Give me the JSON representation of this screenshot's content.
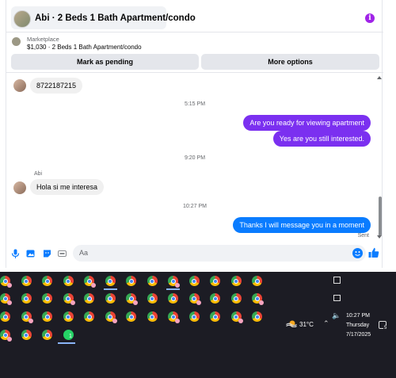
{
  "header": {
    "title": "Abi · 2 Beds 1 Bath Apartment/condo",
    "info_icon": "info-icon",
    "accent": "#a023e8"
  },
  "marketplace": {
    "label": "Marketplace",
    "item": "$1,030 · 2 Beds 1 Bath Apartment/condo",
    "buttons": [
      "Mark as pending",
      "More options"
    ]
  },
  "messages": [
    {
      "type": "in",
      "text": "8722187215"
    },
    {
      "type": "time",
      "text": "5:15 PM"
    },
    {
      "type": "out",
      "text": "Are you ready for viewing apartment"
    },
    {
      "type": "out",
      "text": "Yes are you still interested."
    },
    {
      "type": "time",
      "text": "9:20 PM"
    },
    {
      "type": "sender",
      "text": "Abi"
    },
    {
      "type": "in",
      "text": "Hola si me interesa"
    },
    {
      "type": "time",
      "text": "10:27 PM"
    },
    {
      "type": "out",
      "text": "Thanks I will message you in a moment"
    },
    {
      "type": "status",
      "text": "Sent"
    }
  ],
  "composer": {
    "placeholder": "Aa",
    "icons": [
      "microphone-icon",
      "image-icon",
      "sticker-icon",
      "gif-icon",
      "emoji-icon",
      "like-icon"
    ]
  },
  "colors": {
    "outgoing": "#7b30f0",
    "outgoing_latest": "#0a7cff",
    "incoming": "#f0f0f0",
    "taskbar": "#1c1c24"
  },
  "taskbar": {
    "icon_rows": [
      [
        "chrome-icon",
        "chrome-icon",
        "chrome-icon",
        "chrome-icon",
        "chrome-icon",
        "chrome-icon",
        "chrome-icon",
        "chrome-icon",
        "chrome-icon",
        "chrome-icon",
        "chrome-icon",
        "chrome-icon",
        "chrome-icon"
      ],
      [
        "chrome-icon",
        "chrome-icon",
        "chrome-icon",
        "chrome-icon",
        "chrome-icon",
        "chrome-icon",
        "chrome-icon",
        "chrome-icon",
        "chrome-icon",
        "chrome-icon",
        "chrome-icon",
        "chrome-icon",
        "chrome-icon"
      ],
      [
        "chrome-icon",
        "chrome-icon",
        "chrome-icon",
        "chrome-icon",
        "chrome-icon",
        "chrome-icon",
        "chrome-icon",
        "chrome-icon",
        "chrome-icon",
        "chrome-icon",
        "chrome-icon",
        "chrome-icon",
        "chrome-icon"
      ],
      [
        "chrome-icon",
        "chrome-icon",
        "chrome-icon",
        "whatsapp-icon"
      ]
    ],
    "whatsapp_badge": "1",
    "weather": "31°C",
    "time": "10:27 PM",
    "day": "Thursday",
    "date": "7/17/2025",
    "notifications": "5"
  }
}
